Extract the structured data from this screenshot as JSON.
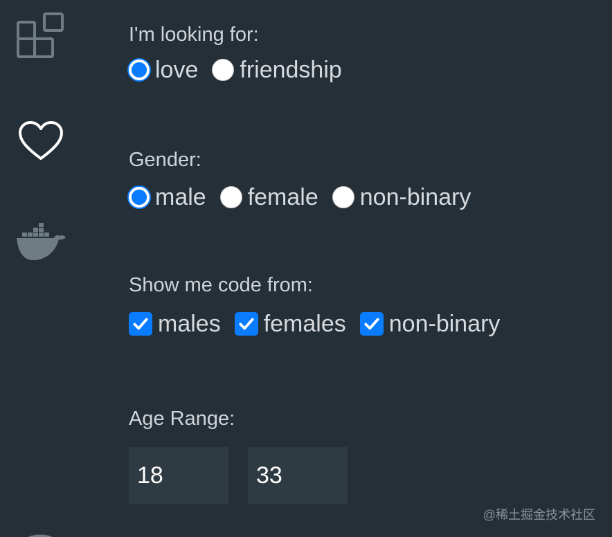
{
  "activity_bar": {
    "icons": [
      "extensions-icon",
      "heart-icon",
      "docker-icon",
      "partial-circle-icon"
    ]
  },
  "looking_for": {
    "label": "I'm looking for:",
    "options": [
      {
        "label": "love",
        "checked": true
      },
      {
        "label": "friendship",
        "checked": false
      }
    ]
  },
  "gender": {
    "label": "Gender:",
    "options": [
      {
        "label": "male",
        "checked": true
      },
      {
        "label": "female",
        "checked": false
      },
      {
        "label": "non-binary",
        "checked": false
      }
    ]
  },
  "show_code_from": {
    "label": "Show me code from:",
    "options": [
      {
        "label": "males",
        "checked": true
      },
      {
        "label": "females",
        "checked": true
      },
      {
        "label": "non-binary",
        "checked": true
      }
    ]
  },
  "age_range": {
    "label": "Age Range:",
    "min": "18",
    "max": "33"
  },
  "watermark": "@稀土掘金技术社区",
  "colors": {
    "background": "#252f38",
    "accent": "#0a7cff",
    "input_bg": "#2f3b42",
    "text": "#cfd4d8",
    "icon": "#6f7c84"
  }
}
